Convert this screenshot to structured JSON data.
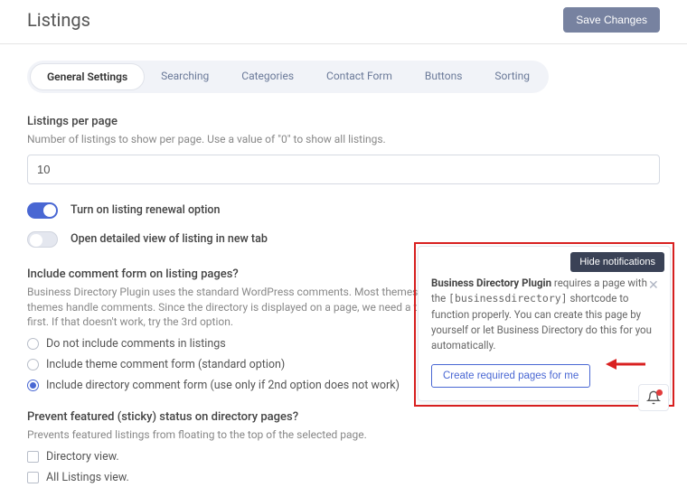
{
  "header": {
    "title": "Listings",
    "save_label": "Save Changes"
  },
  "tabs": [
    {
      "label": "General Settings",
      "active": true
    },
    {
      "label": "Searching",
      "active": false
    },
    {
      "label": "Categories",
      "active": false
    },
    {
      "label": "Contact Form",
      "active": false
    },
    {
      "label": "Buttons",
      "active": false
    },
    {
      "label": "Sorting",
      "active": false
    }
  ],
  "listings_per_page": {
    "label": "Listings per page",
    "desc": "Number of listings to show per page. Use a value of \"0\" to show all listings.",
    "value": "10"
  },
  "toggles": {
    "renewal": {
      "label": "Turn on listing renewal option",
      "on": true
    },
    "new_tab": {
      "label": "Open detailed view of listing in new tab",
      "on": false
    }
  },
  "comment_form": {
    "label": "Include comment form on listing pages?",
    "desc": "Business Directory Plugin uses the standard WordPress comments. Most themes allow for comments on posts, not pages. Some themes handle comments. Since the directory is displayed on a page, we need a theme that can handle both. Use the 2nd option first. If that doesn't work, try the 3rd option.",
    "options": [
      "Do not include comments in listings",
      "Include theme comment form (standard option)",
      "Include directory comment form (use only if 2nd option does not work)"
    ],
    "selected": 2
  },
  "sticky": {
    "label": "Prevent featured (sticky) status on directory pages?",
    "desc": "Prevents featured listings from floating to the top of the selected page.",
    "options": [
      "Directory view.",
      "All Listings view."
    ]
  },
  "notification": {
    "hide_label": "Hide notifications",
    "text_prefix": "Business Directory Plugin",
    "text_mid1": " requires a page with the ",
    "shortcode": "[businessdirectory]",
    "text_mid2": " shortcode to function properly. You can create this page by yourself or let Business Directory do this for you automatically.",
    "button_label": "Create required pages for me"
  }
}
